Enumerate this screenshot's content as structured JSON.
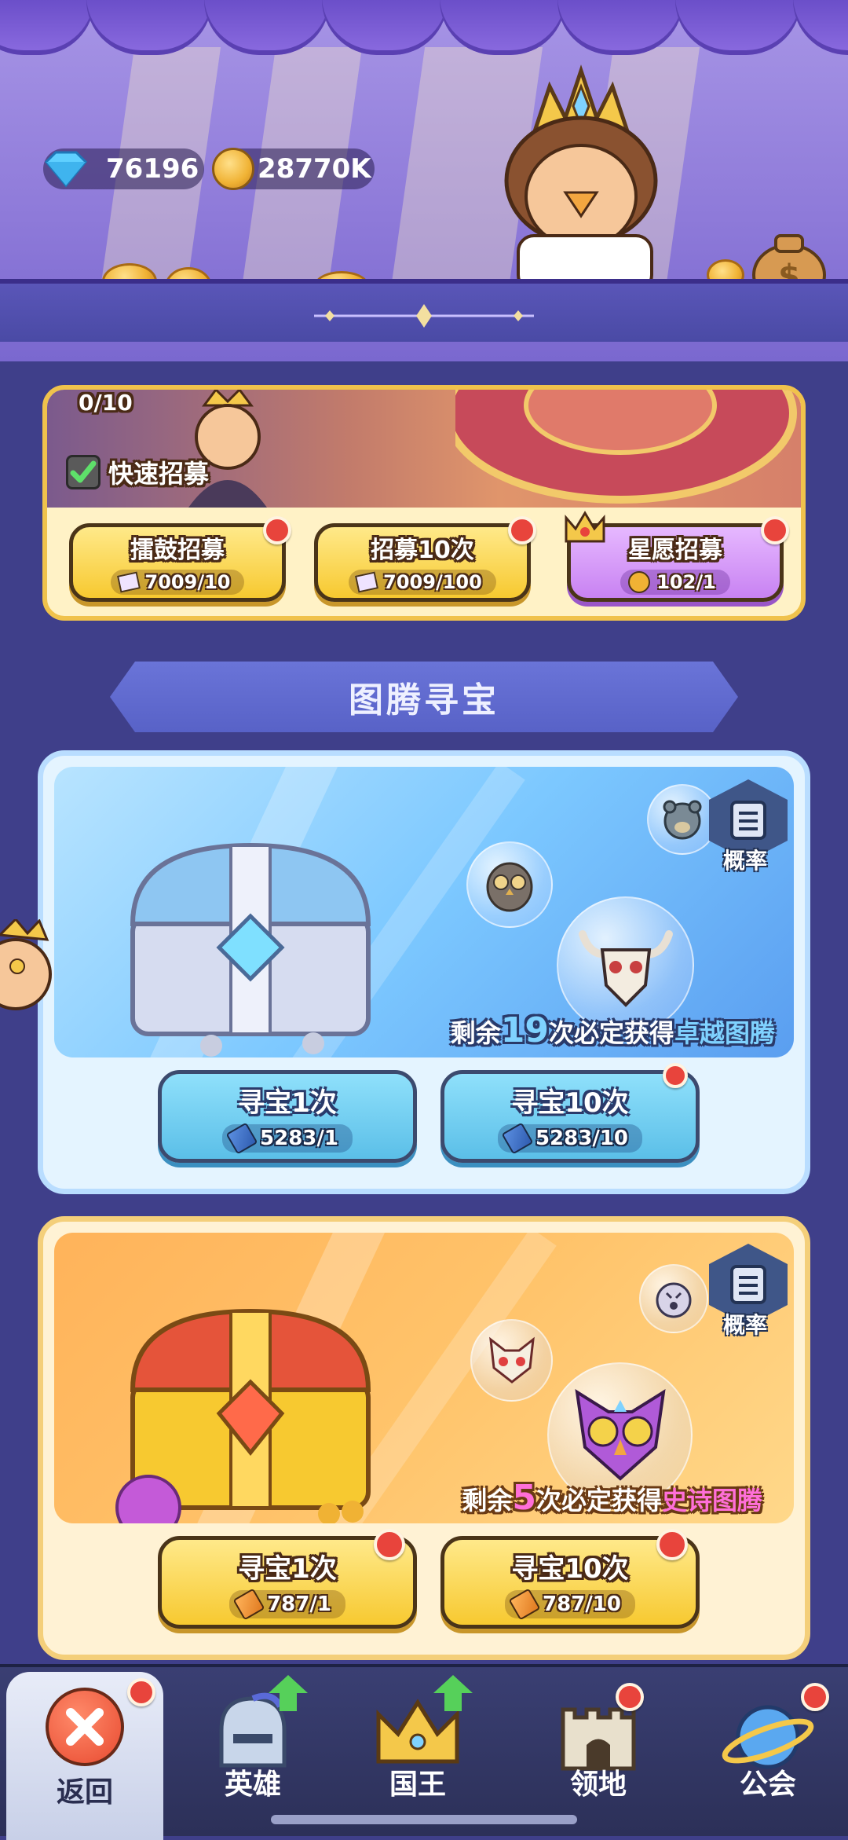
{
  "header": {
    "gems": "76196",
    "gold": "28770K"
  },
  "recruit": {
    "progress": "0/10",
    "quick_recruit_label": "快速招募",
    "quick_recruit_checked": true,
    "buttons": [
      {
        "title": "擂鼓招募",
        "cost": "7009/10",
        "badge": true
      },
      {
        "title": "招募10次",
        "cost": "7009/100",
        "badge": true
      },
      {
        "title": "星愿招募",
        "cost": "102/1",
        "badge": true
      }
    ]
  },
  "section_title": "图腾寻宝",
  "chests": [
    {
      "theme": "blue",
      "prob_label": "概率",
      "guarantee_prefix": "剩余",
      "guarantee_count": "19",
      "guarantee_mid": "次必定获得",
      "guarantee_reward": "卓越图腾",
      "buttons": [
        {
          "title": "寻宝1次",
          "cost": "5283/1",
          "badge": false
        },
        {
          "title": "寻宝10次",
          "cost": "5283/10",
          "badge": true
        }
      ]
    },
    {
      "theme": "gold",
      "prob_label": "概率",
      "guarantee_prefix": "剩余",
      "guarantee_count": "5",
      "guarantee_mid": "次必定获得",
      "guarantee_reward": "史诗图腾",
      "buttons": [
        {
          "title": "寻宝1次",
          "cost": "787/1",
          "badge": true
        },
        {
          "title": "寻宝10次",
          "cost": "787/10",
          "badge": true
        }
      ]
    }
  ],
  "nav": [
    {
      "label": "返回",
      "icon": "close-icon",
      "badge": true,
      "upgrade": false
    },
    {
      "label": "英雄",
      "icon": "helmet-icon",
      "badge": false,
      "upgrade": true
    },
    {
      "label": "国王",
      "icon": "crown-icon",
      "badge": false,
      "upgrade": true
    },
    {
      "label": "领地",
      "icon": "castle-icon",
      "badge": true,
      "upgrade": false
    },
    {
      "label": "公会",
      "icon": "planet-icon",
      "badge": true,
      "upgrade": false
    }
  ],
  "colors": {
    "background": "#3f3f8a",
    "gold_button": "#f7c930",
    "blue_button": "#5bbfe8",
    "purple_button": "#c882f2",
    "badge_red": "#e8443c",
    "reward_blue": "#7fd2ff",
    "reward_pink": "#ff6fd8"
  }
}
